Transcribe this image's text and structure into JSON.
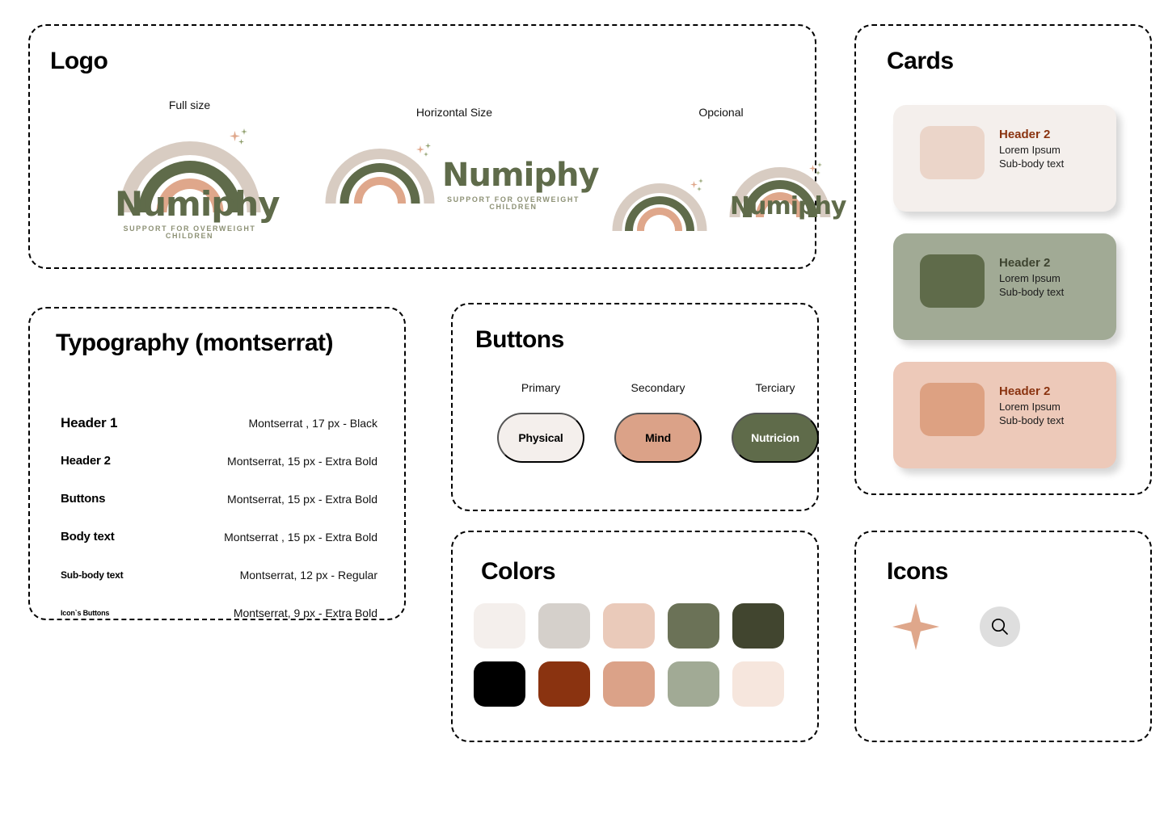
{
  "brand": {
    "name": "Numiphy",
    "tagline": "SUPPORT FOR OVERWEIGHT CHILDREN"
  },
  "logo_section": {
    "title": "Logo",
    "variants": [
      {
        "caption": "Full size"
      },
      {
        "caption": "Horizontal Size"
      },
      {
        "caption": "Opcional"
      }
    ]
  },
  "typography": {
    "title": "Typography (montserrat)",
    "rows": [
      {
        "label": "Header 1",
        "spec": "Montserrat , 17 px - Black",
        "label_size": "17px"
      },
      {
        "label": "Header 2",
        "spec": "Montserrat, 15 px - Extra Bold",
        "label_size": "15px"
      },
      {
        "label": "Buttons",
        "spec": "Montserrat, 15 px - Extra Bold",
        "label_size": "15px"
      },
      {
        "label": "Body text",
        "spec": "Montserrat , 15 px - Extra Bold",
        "label_size": "15px"
      },
      {
        "label": "Sub-body text",
        "spec": "Montserrat, 12 px - Regular",
        "label_size": "12px"
      },
      {
        "label": "Icon`s Buttons",
        "spec": "Montserrat,  9 px - Extra Bold",
        "label_size": "9px"
      }
    ]
  },
  "buttons": {
    "title": "Buttons",
    "items": [
      {
        "caption": "Primary",
        "label": "Physical",
        "bg": "#F4EFEC",
        "fg": "#000000"
      },
      {
        "caption": "Secondary",
        "label": "Mind",
        "bg": "#DBA288",
        "fg": "#000000"
      },
      {
        "caption": "Terciary",
        "label": "Nutricion",
        "bg": "#5F6B4A",
        "fg": "#FFFFFF"
      }
    ]
  },
  "colors": {
    "title": "Colors",
    "swatches": [
      {
        "name": "cream-white",
        "hex": "#F4EFEC"
      },
      {
        "name": "light-gray",
        "hex": "#D5D0CB"
      },
      {
        "name": "peach",
        "hex": "#EACABA"
      },
      {
        "name": "olive-green",
        "hex": "#6B7257"
      },
      {
        "name": "dark-olive",
        "hex": "#41452F"
      },
      {
        "name": "black",
        "hex": "#000000"
      },
      {
        "name": "rust-brown",
        "hex": "#8A3310"
      },
      {
        "name": "salmon",
        "hex": "#DBA288"
      },
      {
        "name": "sage-green",
        "hex": "#A1AA95"
      },
      {
        "name": "blush-cream",
        "hex": "#F6E6DD"
      }
    ]
  },
  "cards": {
    "title": "Cards",
    "items": [
      {
        "header": "Header 2",
        "body_line1": "Lorem Ipsum",
        "body_line2": "Sub-body text",
        "bg": "#F4EFEC",
        "thumb": "#EBD5C9",
        "header_color": "#8A3310",
        "body_color": "#1c1c1c"
      },
      {
        "header": "Header 2",
        "body_line1": "Lorem Ipsum",
        "body_line2": "Sub-body text",
        "bg": "#A1AA95",
        "thumb": "#5F6B4A",
        "header_color": "#3E4430",
        "body_color": "#1c1c1c"
      },
      {
        "header": "Header 2",
        "body_line1": "Lorem Ipsum",
        "body_line2": "Sub-body text",
        "bg": "#EDC9B9",
        "thumb": "#DDA182",
        "header_color": "#8A3310",
        "body_color": "#1c1c1c"
      }
    ]
  },
  "icons": {
    "title": "Icons",
    "items": [
      {
        "name": "sparkle-star-icon",
        "color": "#DFA78B"
      },
      {
        "name": "search-icon",
        "color": "#000000",
        "circle_bg": "#DEDEDE"
      }
    ]
  },
  "palette": {
    "rainbow_outer": "#D8CCC2",
    "rainbow_mid": "#5F6B4A",
    "rainbow_inner": "#DFA78B",
    "wordmark": "#5F6B4A",
    "tagline": "#8D9175"
  }
}
